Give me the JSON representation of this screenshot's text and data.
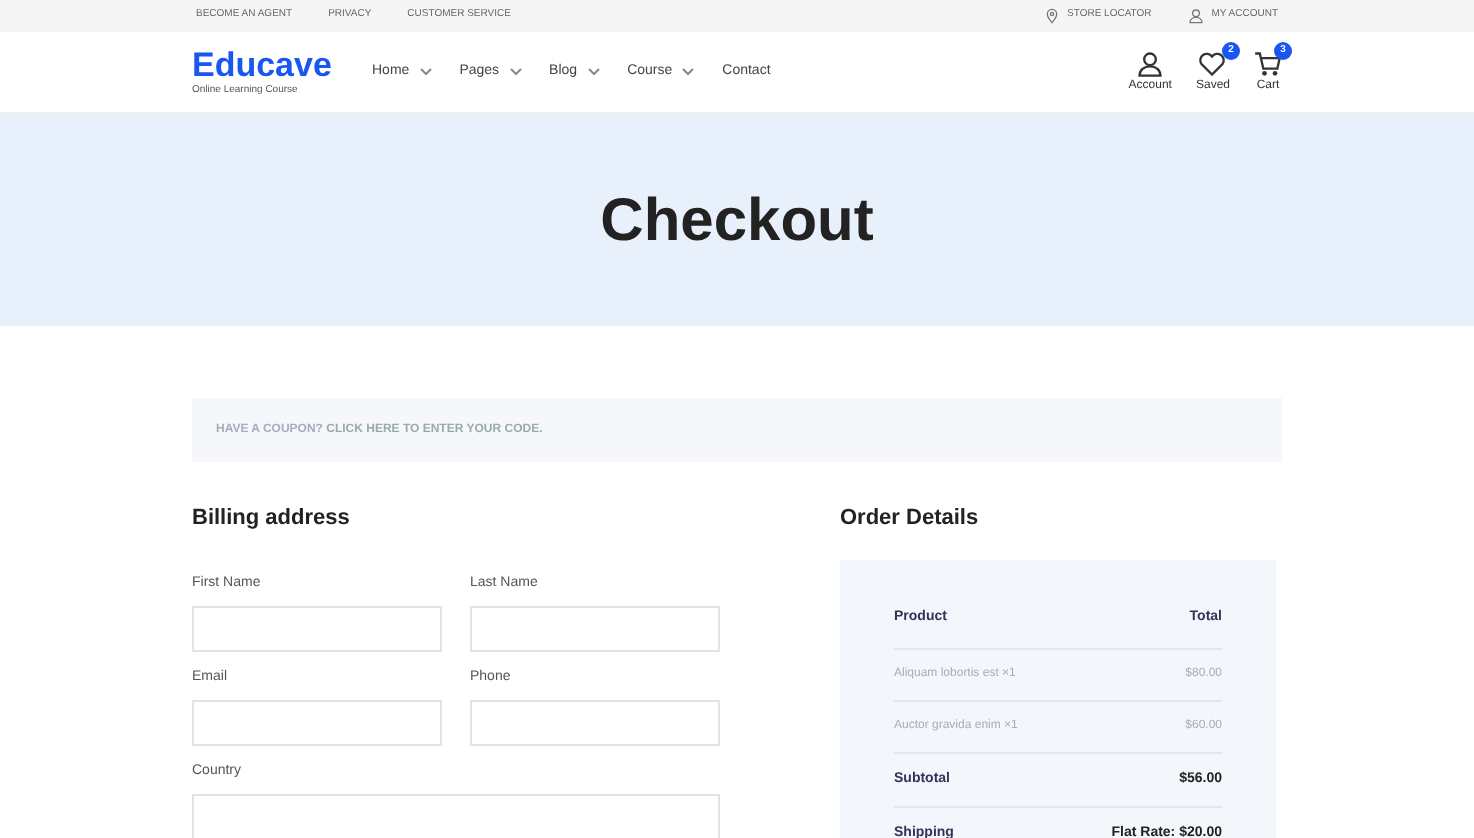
{
  "top_bar": {
    "links": [
      "BECOME AN AGENT",
      "PRIVACY",
      "CUSTOMER SERVICE"
    ],
    "right_links": [
      {
        "kind": "pin",
        "label": "STORE LOCATOR"
      },
      {
        "kind": "user",
        "label": "MY ACCOUNT"
      }
    ]
  },
  "header": {
    "logo": "Educave",
    "tagline": "Online Learning Course",
    "nav": [
      {
        "label": "Home",
        "dropdown": true
      },
      {
        "label": "Pages",
        "dropdown": true
      },
      {
        "label": "Blog",
        "dropdown": true
      },
      {
        "label": "Course",
        "dropdown": true
      },
      {
        "label": "Contact",
        "dropdown": false
      }
    ],
    "actions": [
      {
        "kind": "user",
        "label": "Account"
      },
      {
        "kind": "heart",
        "label": "Saved",
        "badge": "2"
      },
      {
        "kind": "cart",
        "label": "Cart",
        "badge": "3"
      }
    ]
  },
  "hero": {
    "title": "Checkout"
  },
  "coupon": {
    "text": "HAVE A COUPON?",
    "link": "CLICK HERE TO ENTER YOUR CODE."
  },
  "billing": {
    "title": "Billing address",
    "fields": [
      {
        "label": "First Name"
      },
      {
        "label": "Last Name"
      },
      {
        "label": "Email"
      },
      {
        "label": "Phone"
      },
      {
        "label": "Country",
        "wide": true
      }
    ]
  },
  "order": {
    "title": "Order Details",
    "columns": [
      "Product",
      "Total"
    ],
    "items": [
      {
        "name": "Aliquam lobortis est",
        "qty": "×1",
        "price": "$80.00"
      },
      {
        "name": "Auctor gravida enim",
        "qty": "×1",
        "price": "$60.00"
      }
    ],
    "totals": [
      {
        "label": "Subtotal",
        "value": "$56.00"
      },
      {
        "label": "Shipping",
        "value": "Flat Rate: $20.00"
      }
    ]
  }
}
